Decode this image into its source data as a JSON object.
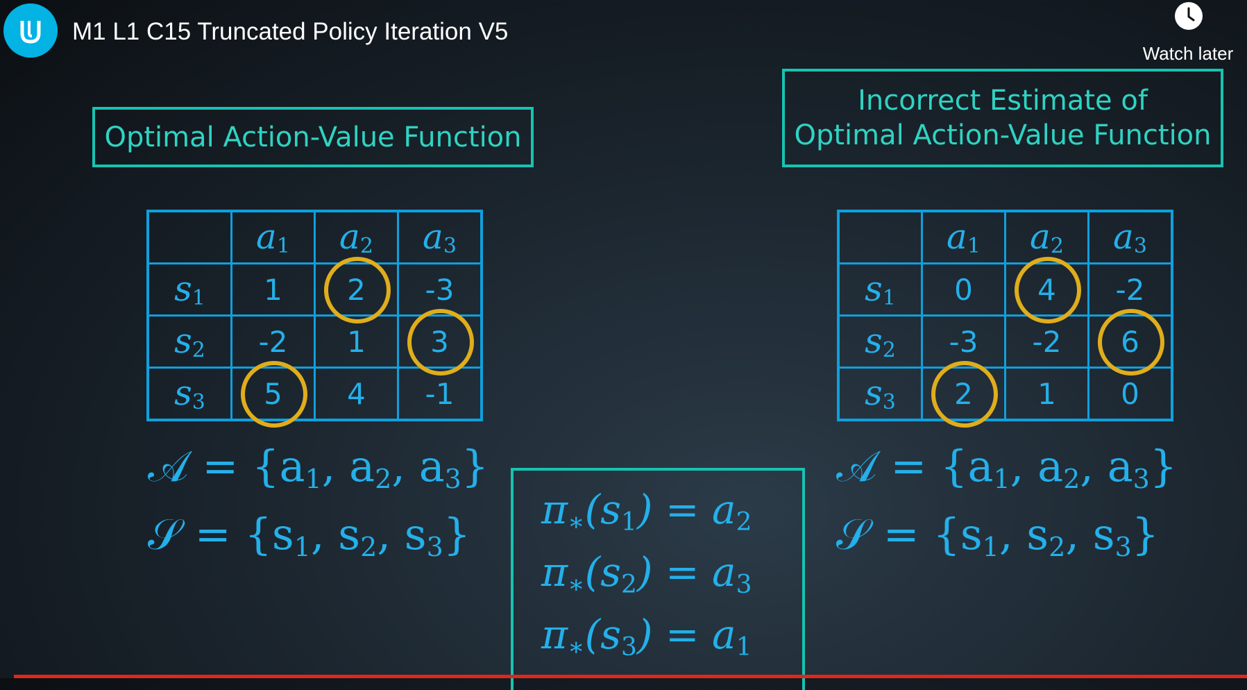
{
  "video": {
    "title": "M1 L1 C15 Truncated Policy Iteration V5",
    "watch_later_label": "Watch later"
  },
  "left_panel": {
    "heading": "Optimal Action-Value Function",
    "columns": [
      "a1",
      "a2",
      "a3"
    ],
    "rows": [
      {
        "state": "s1",
        "values": [
          "1",
          "2",
          "-3"
        ],
        "circled": 1
      },
      {
        "state": "s2",
        "values": [
          "-2",
          "1",
          "3"
        ],
        "circled": 2
      },
      {
        "state": "s3",
        "values": [
          "5",
          "4",
          "-1"
        ],
        "circled": 0
      }
    ]
  },
  "right_panel": {
    "heading_line1": "Incorrect Estimate of",
    "heading_line2": "Optimal Action-Value Function",
    "columns": [
      "a1",
      "a2",
      "a3"
    ],
    "rows": [
      {
        "state": "s1",
        "values": [
          "0",
          "4",
          "-2"
        ],
        "circled": 1
      },
      {
        "state": "s2",
        "values": [
          "-3",
          "-2",
          "6"
        ],
        "circled": 2
      },
      {
        "state": "s3",
        "values": [
          "2",
          "1",
          "0"
        ],
        "circled": 0
      }
    ]
  },
  "sets": {
    "actions": "𝒜 = {a1, a2, a3}",
    "states": "𝒮 = {s1, s2, s3}"
  },
  "policy": [
    "π*(s1) = a2",
    "π*(s2) = a3",
    "π*(s3) = a1"
  ],
  "colors": {
    "accent_teal": "#17c3b2",
    "table_blue": "#0fa0dd",
    "math_blue": "#24b0ea",
    "highlight_ring": "#e0ad1c",
    "logo": "#02b3e4",
    "progress": "#e0271a"
  },
  "icons": [
    "udacity-logo-icon",
    "clock-icon"
  ]
}
